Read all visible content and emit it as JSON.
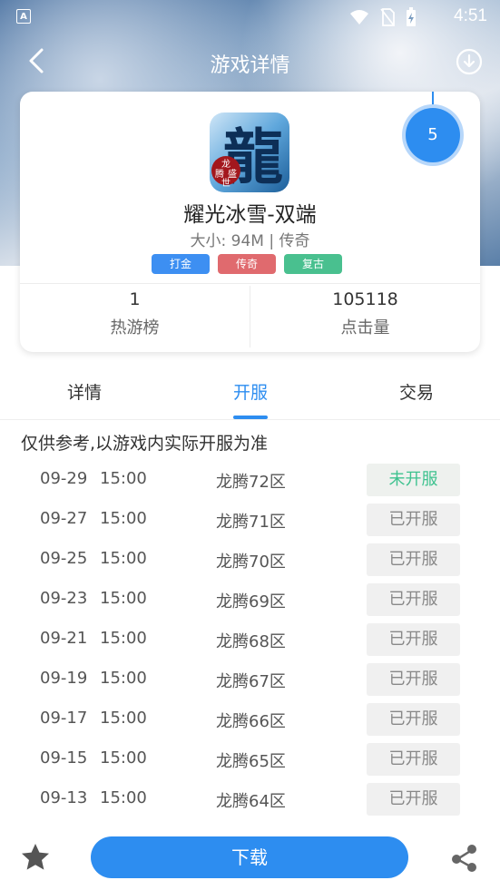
{
  "status_bar": {
    "time": "4:51",
    "left_icon": "A"
  },
  "header": {
    "title": "游戏详情"
  },
  "app": {
    "name": "耀光冰雪-双端",
    "meta": "大小: 94M | 传奇",
    "icon_char": "龍",
    "icon_sub": [
      "龙",
      "腾",
      "盛",
      "世"
    ],
    "tags": [
      {
        "label": "打金",
        "color": "#3d8ff2"
      },
      {
        "label": "传奇",
        "color": "#e06a6e"
      },
      {
        "label": "复古",
        "color": "#49c08f"
      }
    ],
    "rank_badge": "5",
    "stats": [
      {
        "value": "1",
        "label": "热游榜"
      },
      {
        "value": "105118",
        "label": "点击量"
      }
    ]
  },
  "tabs": [
    {
      "label": "详情"
    },
    {
      "label": "开服",
      "active": true
    },
    {
      "label": "交易"
    }
  ],
  "servers": {
    "notice": "仅供参考,以游戏内实际开服为准",
    "rows": [
      {
        "date": "09-29",
        "time": "15:00",
        "name": "龙腾72区",
        "status": "未开服"
      },
      {
        "date": "09-27",
        "time": "15:00",
        "name": "龙腾71区",
        "status": "已开服"
      },
      {
        "date": "09-25",
        "time": "15:00",
        "name": "龙腾70区",
        "status": "已开服"
      },
      {
        "date": "09-23",
        "time": "15:00",
        "name": "龙腾69区",
        "status": "已开服"
      },
      {
        "date": "09-21",
        "time": "15:00",
        "name": "龙腾68区",
        "status": "已开服"
      },
      {
        "date": "09-19",
        "time": "15:00",
        "name": "龙腾67区",
        "status": "已开服"
      },
      {
        "date": "09-17",
        "time": "15:00",
        "name": "龙腾66区",
        "status": "已开服"
      },
      {
        "date": "09-15",
        "time": "15:00",
        "name": "龙腾65区",
        "status": "已开服"
      },
      {
        "date": "09-13",
        "time": "15:00",
        "name": "龙腾64区",
        "status": "已开服"
      }
    ]
  },
  "bottom_bar": {
    "download_label": "下载",
    "star_icon": "star-icon",
    "share_icon": "share-icon"
  },
  "colors": {
    "accent": "#2d8df0",
    "open_soon": "#3ec28f"
  }
}
